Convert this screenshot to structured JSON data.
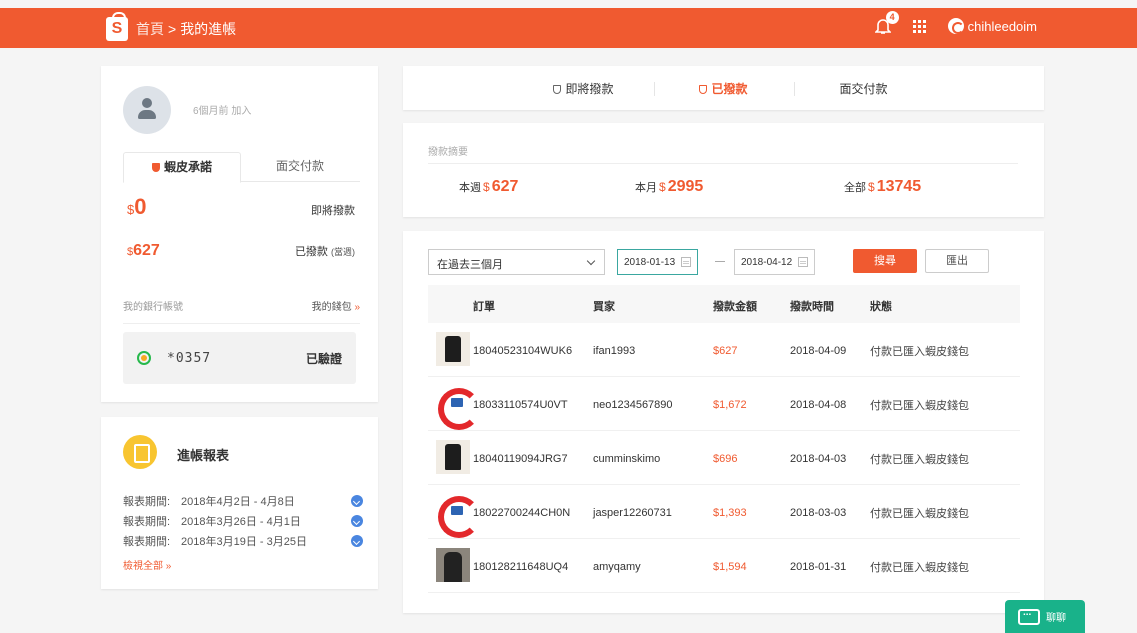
{
  "header": {
    "logo_letter": "S",
    "breadcrumb_home": "首頁",
    "breadcrumb_sep": ">",
    "breadcrumb_current": "我的進帳",
    "notification_count": "4",
    "username": "chihleedoim"
  },
  "profile": {
    "joined": "6個月前 加入",
    "tabs": [
      "蝦皮承諾",
      "面交付款"
    ],
    "pending": {
      "currency": "$",
      "amount": "0",
      "label": "即將撥款"
    },
    "paid": {
      "currency": "$",
      "amount": "627",
      "label": "已撥款",
      "label_note": "(當週)"
    },
    "bank_label": "我的銀行帳號",
    "wallet_link": "我的錢包",
    "wallet_arrow": "»",
    "bank_number": "*0357",
    "bank_status": "已驗證"
  },
  "report": {
    "title": "進帳報表",
    "items": [
      {
        "label": "報表期間:",
        "period": "2018年4月2日 - 4月8日"
      },
      {
        "label": "報表期間:",
        "period": "2018年3月26日 - 4月1日"
      },
      {
        "label": "報表期間:",
        "period": "2018年3月19日 - 3月25日"
      }
    ],
    "view_all": "檢視全部 »"
  },
  "payout_tabs": [
    "即將撥款",
    "已撥款",
    "面交付款"
  ],
  "summary": {
    "title": "撥款摘要",
    "week": {
      "label": "本週",
      "currency": "$",
      "value": "627"
    },
    "month": {
      "label": "本月",
      "currency": "$",
      "value": "2995"
    },
    "total": {
      "label": "全部",
      "currency": "$",
      "value": "13745"
    }
  },
  "filters": {
    "range_option": "在過去三個月",
    "date_from": "2018-01-13",
    "date_to": "2018-04-12",
    "search_button": "搜尋",
    "export_button": "匯出"
  },
  "table": {
    "headers": [
      "訂單",
      "買家",
      "撥款金額",
      "撥款時間",
      "狀態"
    ],
    "rows": [
      {
        "order": "18040523104WUK6",
        "buyer": "ifan1993",
        "amount": "$627",
        "time": "2018-04-09",
        "status": "付款已匯入蝦皮錢包"
      },
      {
        "order": "18033110574U0VT",
        "buyer": "neo1234567890",
        "amount": "$1,672",
        "time": "2018-04-08",
        "status": "付款已匯入蝦皮錢包"
      },
      {
        "order": "18040119094JRG7",
        "buyer": "cumminskimo",
        "amount": "$696",
        "time": "2018-04-03",
        "status": "付款已匯入蝦皮錢包"
      },
      {
        "order": "18022700244CH0N",
        "buyer": "jasper12260731",
        "amount": "$1,393",
        "time": "2018-03-03",
        "status": "付款已匯入蝦皮錢包"
      },
      {
        "order": "180128211648UQ4",
        "buyer": "amyqamy",
        "amount": "$1,594",
        "time": "2018-01-31",
        "status": "付款已匯入蝦皮錢包"
      }
    ]
  },
  "chat": {
    "label": "聊聊"
  },
  "colors": {
    "brand": "#f05a30",
    "chat": "#19b28a"
  }
}
